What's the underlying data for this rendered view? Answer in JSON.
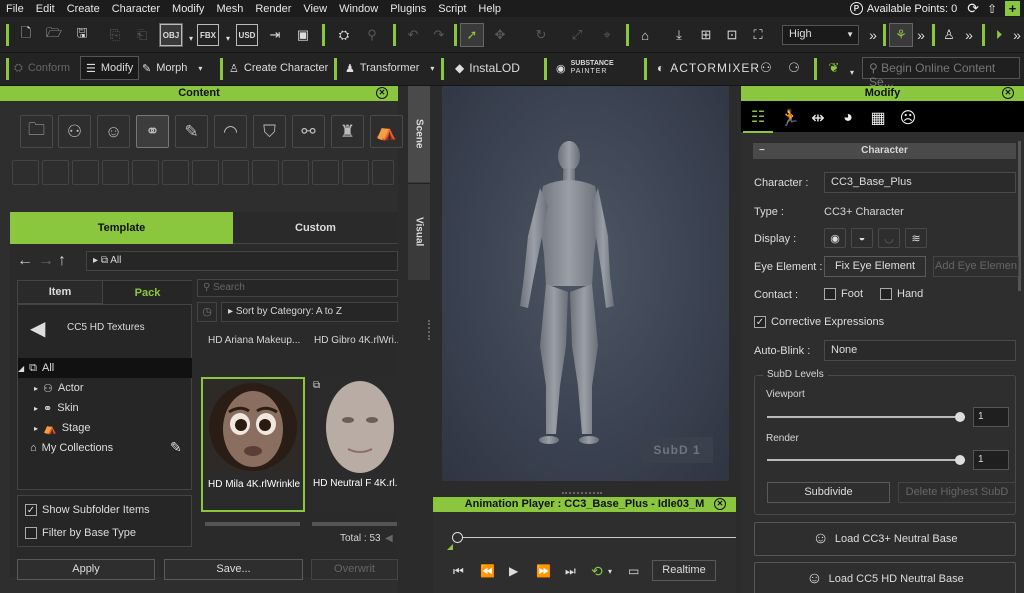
{
  "menubar": {
    "items": [
      "File",
      "Edit",
      "Create",
      "Character",
      "Modify",
      "Mesh",
      "Render",
      "View",
      "Window",
      "Plugins",
      "Script",
      "Help"
    ],
    "points_label": "Available Points: 0"
  },
  "toolbar1": {
    "quality": "High",
    "more": "»"
  },
  "toolbar2": {
    "conform": "Conform",
    "modify": "Modify",
    "morph": "Morph",
    "create_character": "Create Character",
    "transformer": "Transformer",
    "instalod": "InstaLOD",
    "substance_top": "SUBSTANCE",
    "substance_bottom": "PAINTER",
    "actormixer": "ACTORMIXER",
    "search_placeholder": "Begin Online Content Se..."
  },
  "content": {
    "title": "Content",
    "tabs": [
      "Template",
      "Custom"
    ],
    "breadcrumb": "All",
    "subtabs": [
      "Item",
      "Pack"
    ],
    "pack_name": "CC5 HD Textures",
    "tree": [
      "All",
      "Actor",
      "Skin",
      "Stage",
      "My Collections"
    ],
    "search_placeholder": "Search",
    "sort": "Sort by Category: A to Z",
    "list_items": [
      "HD Ariana Makeup...",
      "HD Gibro 4K.rlWri..."
    ],
    "thumbs": [
      "HD Mila 4K.rlWrinkle",
      "HD Neutral F 4K.rl..."
    ],
    "show_subfolder": "Show Subfolder Items",
    "filter_base": "Filter by Base Type",
    "total": "Total : 53",
    "apply": "Apply",
    "save": "Save...",
    "overwrite": "Overwrit"
  },
  "sidetabs": [
    "Scene",
    "Visual"
  ],
  "viewport": {
    "subd": "SubD 1"
  },
  "animation": {
    "title": "Animation Player : CC3_Base_Plus - Idle03_M",
    "realtime": "Realtime"
  },
  "modify": {
    "title": "Modify",
    "section": "Character",
    "collapse": "−",
    "character_label": "Character :",
    "character_value": "CC3_Base_Plus",
    "type_label": "Type :",
    "type_value": "CC3+ Character",
    "display_label": "Display :",
    "eye_label": "Eye Element :",
    "fix_eye": "Fix Eye Element",
    "add_eye": "Add Eye Elemen",
    "contact_label": "Contact :",
    "foot": "Foot",
    "hand": "Hand",
    "corrective": "Corrective Expressions",
    "autoblink_label": "Auto-Blink :",
    "autoblink_value": "None",
    "subd_levels": "SubD Levels",
    "viewport": "Viewport",
    "viewport_value": "1",
    "render": "Render",
    "render_value": "1",
    "subdivide": "Subdivide",
    "delete_highest": "Delete Highest SubD",
    "load_cc3": "Load CC3+ Neutral Base",
    "load_cc5": "Load CC5 HD Neutral Base"
  },
  "colors": {
    "accent": "#8bc63f",
    "panel": "#2e2e2e",
    "menubar": "#1c1c1c"
  }
}
